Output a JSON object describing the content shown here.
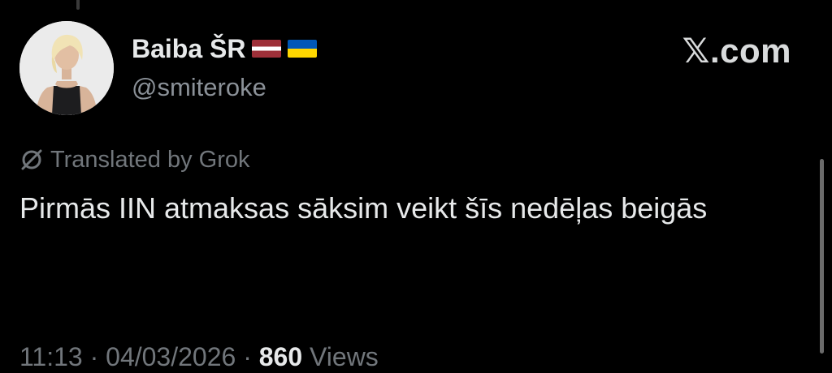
{
  "author": {
    "display_name": "Baiba ŠR",
    "handle": "@smiteroke",
    "avatar_icon": "profile-photo",
    "flags": [
      "latvia-flag-icon",
      "ukraine-flag-icon"
    ]
  },
  "brand": {
    "label": "𝕏.com"
  },
  "translation": {
    "icon": "translate-icon",
    "label": "Translated by Grok"
  },
  "tweet": {
    "text": "Pirmās IIN atmaksas sāksim veikt šīs nedēļas beigās"
  },
  "meta": {
    "time": "11:13",
    "separator_1": " · ",
    "date": "04/03/2026",
    "separator_2": " · ",
    "views_count": "860",
    "views_label": " Views"
  },
  "colors": {
    "background": "#000000",
    "primary_text": "#e7e9ea",
    "secondary_text": "#71767b",
    "latvia_red": "#9e3039",
    "ukraine_blue": "#0057b7",
    "ukraine_yellow": "#ffd700"
  }
}
